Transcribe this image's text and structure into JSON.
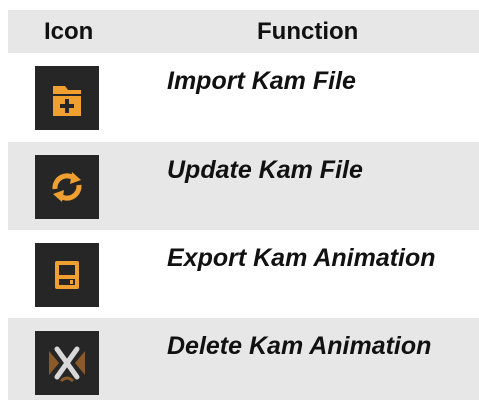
{
  "header": {
    "icon_col": "Icon",
    "function_col": "Function"
  },
  "colors": {
    "accent": "#f0a030",
    "icon_bg": "#262626",
    "row_alt": "#e7e7e7"
  },
  "rows": [
    {
      "icon": "folder-add-icon",
      "label": "Import Kam File"
    },
    {
      "icon": "refresh-icon",
      "label": "Update Kam File"
    },
    {
      "icon": "save-icon",
      "label": "Export Kam Animation"
    },
    {
      "icon": "delete-animation-icon",
      "label": "Delete Kam Animation"
    }
  ]
}
